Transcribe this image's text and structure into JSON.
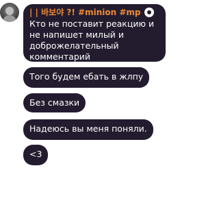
{
  "channel": {
    "name": "| | 바보야 ?! #minion #mp",
    "icon": "minion-avatar-icon"
  },
  "messages": [
    {
      "text": "Кто не поставит реакцию и не напишет милый и доброжелательный комментарий"
    },
    {
      "text": "Того будем ебать в жлпу"
    },
    {
      "text": "Без смазки"
    },
    {
      "text": "Надеюсь вы меня поняли."
    },
    {
      "text": "<3"
    }
  ],
  "colors": {
    "bubble": "#231c2f",
    "channel_name": "#f08a35",
    "text": "#ffffff"
  }
}
